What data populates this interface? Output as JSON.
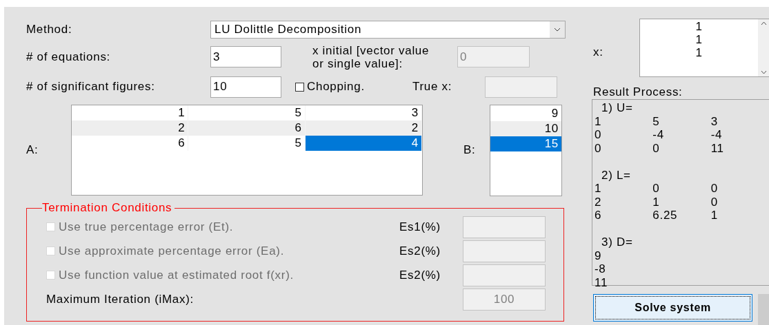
{
  "method": {
    "label": "Method:",
    "value": "LU Dolittle Decomposition"
  },
  "equations": {
    "label": "# of equations:",
    "value": "3"
  },
  "x_initial": {
    "label": "x initial [vector value or single value]:",
    "value": "0",
    "disabled": true
  },
  "significant_figures": {
    "label": "# of significant figures:",
    "value": "10"
  },
  "chopping": {
    "label": "Chopping.",
    "checked": false
  },
  "true_x": {
    "label": "True x:",
    "disabled": true
  },
  "matrix_a": {
    "label": "A:",
    "rows": [
      {
        "cells": [
          {
            "value": "1",
            "selected": false
          },
          {
            "value": "5",
            "selected": false
          },
          {
            "value": "3",
            "selected": false
          }
        ]
      },
      {
        "cells": [
          {
            "value": "2",
            "selected": false
          },
          {
            "value": "6",
            "selected": false
          },
          {
            "value": "2",
            "selected": false
          }
        ]
      },
      {
        "cells": [
          {
            "value": "6",
            "selected": false
          },
          {
            "value": "5",
            "selected": false
          },
          {
            "value": "4",
            "selected": true
          }
        ]
      }
    ]
  },
  "vector_b": {
    "label": "B:",
    "items": [
      {
        "value": "9",
        "selected": false
      },
      {
        "value": "10",
        "selected": false
      },
      {
        "value": "15",
        "selected": true
      }
    ]
  },
  "termination": {
    "title": "Termination Conditions",
    "disabled": true,
    "conditions": [
      {
        "label": "Use true percentage error (Et).",
        "checked": false,
        "es_label": "Es1(%)"
      },
      {
        "label": "Use approximate percentage error (Ea).",
        "checked": false,
        "es_label": "Es2(%)"
      },
      {
        "label": "Use function value at estimated root f(xr).",
        "checked": false,
        "es_label": "Es2(%)"
      }
    ],
    "max_iteration": {
      "label": "Maximum Iteration (iMax):",
      "value": "100"
    }
  },
  "x_result": {
    "label": "x:",
    "values": [
      "1",
      "1",
      "1"
    ]
  },
  "result_process": {
    "label": "Result Process:",
    "sections": [
      {
        "title": "1) U=",
        "rows": [
          [
            "1",
            "5",
            "3"
          ],
          [
            "0",
            "-4",
            "-4"
          ],
          [
            "0",
            "0",
            "11"
          ]
        ]
      },
      {
        "title": "2) L=",
        "rows": [
          [
            "1",
            "0",
            "0"
          ],
          [
            "2",
            "1",
            "0"
          ],
          [
            "6",
            "6.25",
            "1"
          ]
        ]
      },
      {
        "title": "3) D=",
        "rows": [
          [
            "9"
          ],
          [
            "-8"
          ],
          [
            "11"
          ]
        ]
      }
    ]
  },
  "solve_button": "Solve system"
}
